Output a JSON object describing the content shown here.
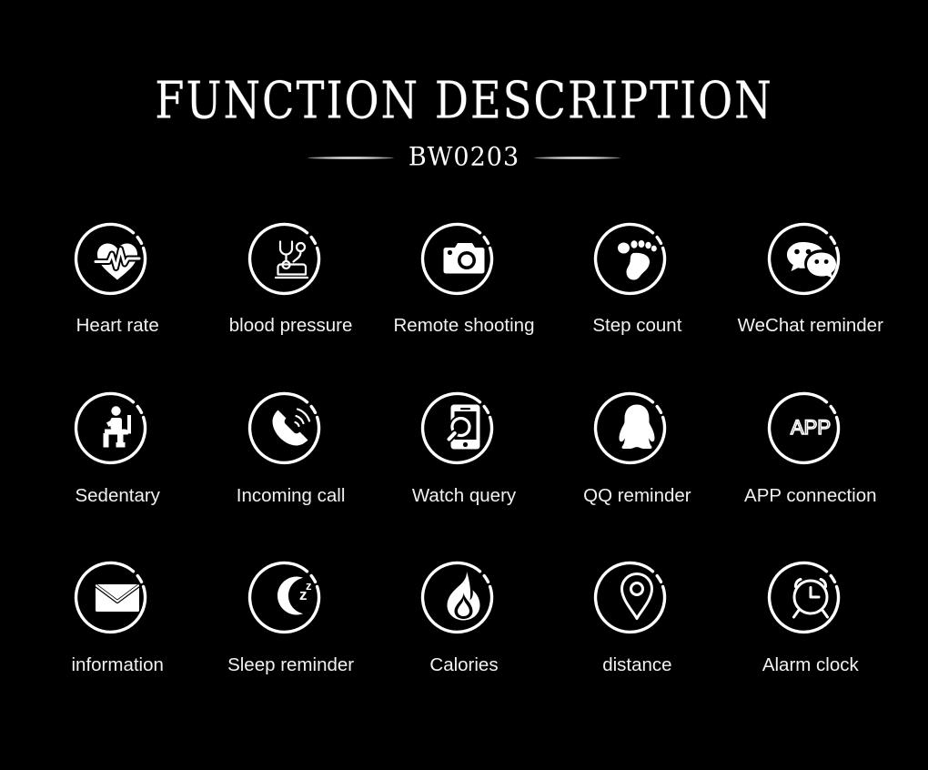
{
  "page": {
    "background_color": "#000000",
    "text_color": "#ffffff"
  },
  "header": {
    "title": "FUNCTION DESCRIPTION",
    "model": "BW0203"
  },
  "grid": {
    "columns": 5,
    "rows": 3,
    "items": [
      {
        "label": "Heart rate",
        "icon": "heart-rate-icon"
      },
      {
        "label": "blood pressure",
        "icon": "blood-pressure-icon"
      },
      {
        "label": "Remote shooting",
        "icon": "camera-icon"
      },
      {
        "label": "Step count",
        "icon": "footprint-icon"
      },
      {
        "label": "WeChat reminder",
        "icon": "wechat-icon"
      },
      {
        "label": "Sedentary",
        "icon": "sitting-person-icon"
      },
      {
        "label": "Incoming call",
        "icon": "phone-call-icon"
      },
      {
        "label": "Watch query",
        "icon": "phone-search-icon"
      },
      {
        "label": "QQ reminder",
        "icon": "qq-penguin-icon"
      },
      {
        "label": "APP connection",
        "icon": "app-text-icon",
        "icon_text": "APP"
      },
      {
        "label": "information",
        "icon": "envelope-icon"
      },
      {
        "label": "Sleep reminder",
        "icon": "moon-sleep-icon",
        "icon_text": "zZ"
      },
      {
        "label": "Calories",
        "icon": "flame-icon"
      },
      {
        "label": "distance",
        "icon": "map-pin-icon"
      },
      {
        "label": "Alarm clock",
        "icon": "alarm-clock-icon"
      }
    ]
  }
}
